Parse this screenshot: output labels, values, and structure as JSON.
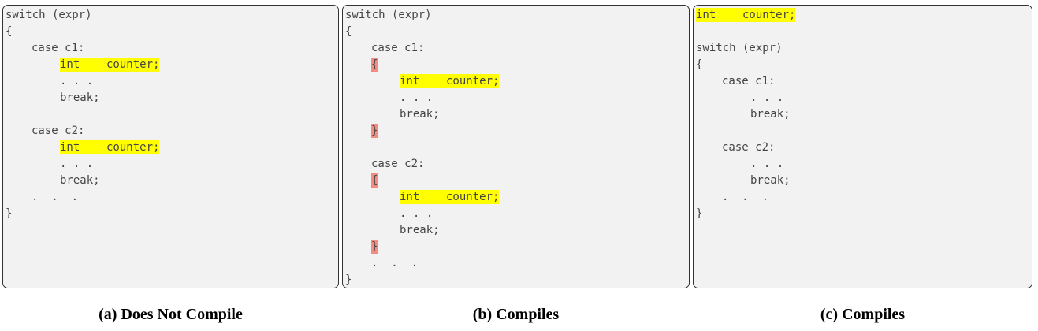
{
  "colors": {
    "panel_bg": "#f2f2f2",
    "declaration_highlight": "#ffff00",
    "brace_highlight": "#f28b82",
    "code_text": "#444444"
  },
  "panels": [
    {
      "id": "a",
      "caption": "(a) Does Not Compile",
      "lines": [
        {
          "text": "switch (expr)",
          "indent": 0,
          "highlight": "none"
        },
        {
          "text": "{",
          "indent": 0,
          "highlight": "none"
        },
        {
          "text": "case c1:",
          "indent": 1,
          "highlight": "none"
        },
        {
          "text": "int    counter;",
          "indent": 2,
          "highlight": "declaration"
        },
        {
          "text": ". . .",
          "indent": 2,
          "highlight": "none"
        },
        {
          "text": "break;",
          "indent": 2,
          "highlight": "none"
        },
        {
          "text": "",
          "indent": 0,
          "highlight": "none"
        },
        {
          "text": "case c2:",
          "indent": 1,
          "highlight": "none"
        },
        {
          "text": "int    counter;",
          "indent": 2,
          "highlight": "declaration"
        },
        {
          "text": ". . .",
          "indent": 2,
          "highlight": "none"
        },
        {
          "text": "break;",
          "indent": 2,
          "highlight": "none"
        },
        {
          "text": ".  .  .",
          "indent": 1,
          "highlight": "none"
        },
        {
          "text": "}",
          "indent": 0,
          "highlight": "none"
        }
      ]
    },
    {
      "id": "b",
      "caption": "(b) Compiles",
      "lines": [
        {
          "text": "switch (expr)",
          "indent": 0,
          "highlight": "none"
        },
        {
          "text": "{",
          "indent": 0,
          "highlight": "none"
        },
        {
          "text": "case c1:",
          "indent": 1,
          "highlight": "none"
        },
        {
          "text": "{",
          "indent": 1,
          "highlight": "brace"
        },
        {
          "text": "int    counter;",
          "indent": 2,
          "highlight": "declaration"
        },
        {
          "text": ". . .",
          "indent": 2,
          "highlight": "none"
        },
        {
          "text": "break;",
          "indent": 2,
          "highlight": "none"
        },
        {
          "text": "}",
          "indent": 1,
          "highlight": "brace"
        },
        {
          "text": "",
          "indent": 0,
          "highlight": "none"
        },
        {
          "text": "case c2:",
          "indent": 1,
          "highlight": "none"
        },
        {
          "text": "{",
          "indent": 1,
          "highlight": "brace"
        },
        {
          "text": "int    counter;",
          "indent": 2,
          "highlight": "declaration"
        },
        {
          "text": ". . .",
          "indent": 2,
          "highlight": "none"
        },
        {
          "text": "break;",
          "indent": 2,
          "highlight": "none"
        },
        {
          "text": "}",
          "indent": 1,
          "highlight": "brace"
        },
        {
          "text": ".  .  .",
          "indent": 1,
          "highlight": "none"
        },
        {
          "text": "}",
          "indent": 0,
          "highlight": "none"
        }
      ]
    },
    {
      "id": "c",
      "caption": "(c) Compiles",
      "lines": [
        {
          "text": "int    counter;",
          "indent": 0,
          "highlight": "declaration"
        },
        {
          "text": "",
          "indent": 0,
          "highlight": "none"
        },
        {
          "text": "switch (expr)",
          "indent": 0,
          "highlight": "none"
        },
        {
          "text": "{",
          "indent": 0,
          "highlight": "none"
        },
        {
          "text": "case c1:",
          "indent": 1,
          "highlight": "none"
        },
        {
          "text": ". . .",
          "indent": 2,
          "highlight": "none"
        },
        {
          "text": "break;",
          "indent": 2,
          "highlight": "none"
        },
        {
          "text": "",
          "indent": 0,
          "highlight": "none"
        },
        {
          "text": "case c2:",
          "indent": 1,
          "highlight": "none"
        },
        {
          "text": ". . .",
          "indent": 2,
          "highlight": "none"
        },
        {
          "text": "break;",
          "indent": 2,
          "highlight": "none"
        },
        {
          "text": ".  .  .",
          "indent": 1,
          "highlight": "none"
        },
        {
          "text": "}",
          "indent": 0,
          "highlight": "none"
        }
      ]
    }
  ]
}
